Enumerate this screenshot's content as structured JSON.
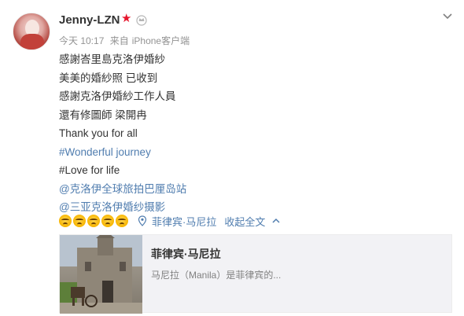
{
  "post": {
    "username": "Jenny-LZN",
    "meta": {
      "time": "今天 10:17",
      "source_prefix": "来自",
      "source": "iPhone客户端"
    },
    "lines": [
      {
        "text": "感謝峇里島克洛伊婚紗",
        "kind": "text"
      },
      {
        "text": "美美的婚紗照 已收到",
        "kind": "text"
      },
      {
        "text": "感謝克洛伊婚紗工作人員",
        "kind": "text"
      },
      {
        "text": "還有修圖師 梁開冉",
        "kind": "text"
      },
      {
        "text": "Thank you for all",
        "kind": "text"
      },
      {
        "text": "#Wonderful journey",
        "kind": "tag"
      },
      {
        "text": "#Love for life",
        "kind": "text"
      },
      {
        "text": "@克洛伊全球旅拍巴厘岛站",
        "kind": "mention"
      },
      {
        "text": "@三亚克洛伊婚纱摄影",
        "kind": "mention"
      }
    ],
    "emoji_count": 5,
    "location": "菲律宾·马尼拉",
    "collapse_label": "收起全文"
  },
  "card": {
    "title": "菲律宾·马尼拉",
    "description": "马尼拉（Manila）是菲律宾的..."
  },
  "icons": {
    "vip_star": "★",
    "crown": "crown-icon",
    "chevron": "chevron-down-icon",
    "location": "location-pin-icon",
    "collapse": "chevron-up-icon"
  },
  "colors": {
    "link_blue": "#507daf",
    "vip_red": "#e6162d",
    "meta_gray": "#939393",
    "card_bg": "#f2f2f5"
  }
}
